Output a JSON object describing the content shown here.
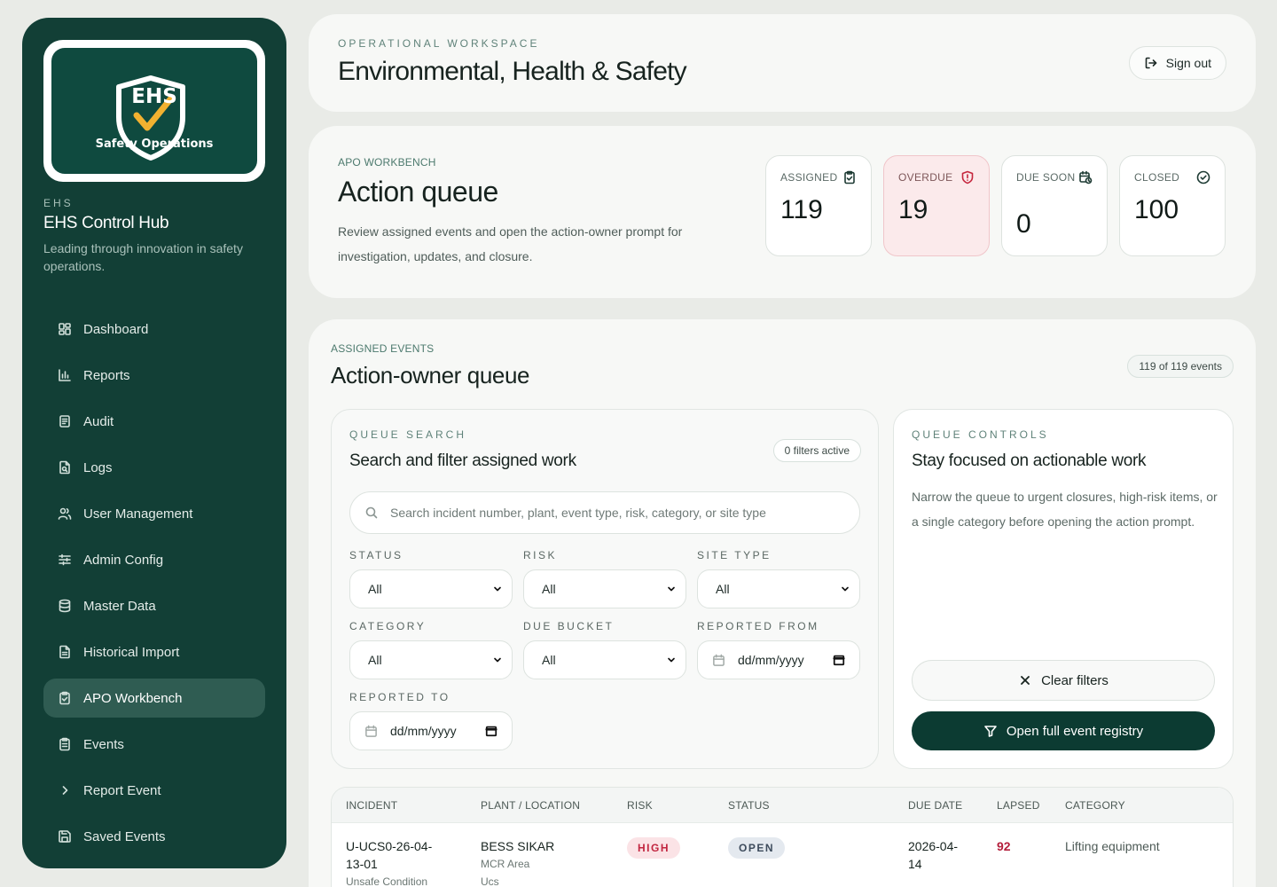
{
  "colors": {
    "sidebar_bg": "#123f36",
    "accent_dark": "#0c3b32",
    "overdue_bg": "#fbeaeb",
    "danger": "#c5263d",
    "page_bg": "#e9ebe7"
  },
  "logo": {
    "word": "EHS",
    "subtitle": "Safety Operations"
  },
  "sidebar": {
    "eyebrow": "EHS",
    "title": "EHS Control Hub",
    "tagline": "Leading through innovation in safety operations.",
    "items": [
      {
        "label": "Dashboard",
        "icon": "dashboard-icon"
      },
      {
        "label": "Reports",
        "icon": "bar-chart-icon"
      },
      {
        "label": "Audit",
        "icon": "audit-icon"
      },
      {
        "label": "Logs",
        "icon": "file-search-icon"
      },
      {
        "label": "User Management",
        "icon": "users-icon"
      },
      {
        "label": "Admin Config",
        "icon": "sliders-icon"
      },
      {
        "label": "Master Data",
        "icon": "database-icon"
      },
      {
        "label": "Historical Import",
        "icon": "file-import-icon"
      },
      {
        "label": "APO Workbench",
        "icon": "clipboard-check-icon",
        "active": true
      },
      {
        "label": "Events",
        "icon": "clipboard-list-icon"
      },
      {
        "label": "Report Event",
        "icon": "chevron-right-icon"
      },
      {
        "label": "Saved Events",
        "icon": "save-icon"
      }
    ]
  },
  "header": {
    "eyebrow": "OPERATIONAL WORKSPACE",
    "title": "Environmental, Health & Safety",
    "sign_out": "Sign out"
  },
  "workbench": {
    "eyebrow": "APO WORKBENCH",
    "title": "Action queue",
    "description": "Review assigned events and open the action-owner prompt for investigation, updates, and closure.",
    "stats": {
      "assigned": {
        "label": "ASSIGNED",
        "value": "119"
      },
      "overdue": {
        "label": "OVERDUE",
        "value": "19"
      },
      "due_soon": {
        "label": "DUE SOON",
        "value": "0"
      },
      "closed": {
        "label": "CLOSED",
        "value": "100"
      }
    }
  },
  "events": {
    "eyebrow": "ASSIGNED EVENTS",
    "title": "Action-owner queue",
    "count": "119 of 119 events",
    "search": {
      "eyebrow": "QUEUE SEARCH",
      "title": "Search and filter assigned work",
      "filters_active": "0 filters active",
      "placeholder": "Search incident number, plant, event type, risk, category, or site type",
      "labels": {
        "status": "STATUS",
        "risk": "RISK",
        "site_type": "SITE TYPE",
        "category": "CATEGORY",
        "due_bucket": "DUE BUCKET",
        "reported_from": "REPORTED FROM",
        "reported_to": "REPORTED TO"
      },
      "values": {
        "status": "All",
        "risk": "All",
        "site_type": "All",
        "category": "All",
        "due_bucket": "All",
        "reported_from": "dd/mm/yyyy",
        "reported_to": "dd/mm/yyyy"
      }
    },
    "controls": {
      "eyebrow": "QUEUE CONTROLS",
      "title": "Stay focused on actionable work",
      "description": "Narrow the queue to urgent closures, high-risk items, or a single category before opening the action prompt.",
      "clear": "Clear filters",
      "registry": "Open full event registry"
    },
    "table": {
      "headers": [
        "INCIDENT",
        "PLANT / LOCATION",
        "RISK",
        "STATUS",
        "DUE DATE",
        "LAPSED",
        "CATEGORY"
      ],
      "rows": [
        {
          "incident_line1": "U-UCS0-26-04-",
          "incident_line2": "13-01",
          "incident_type": "Unsafe Condition",
          "plant": "BESS SIKAR",
          "location": "MCR Area",
          "site_code": "Ucs",
          "risk": "HIGH",
          "status": "OPEN",
          "due_line1": "2026-04-",
          "due_line2": "14",
          "lapsed": "92",
          "category": "Lifting equipment"
        }
      ]
    }
  }
}
